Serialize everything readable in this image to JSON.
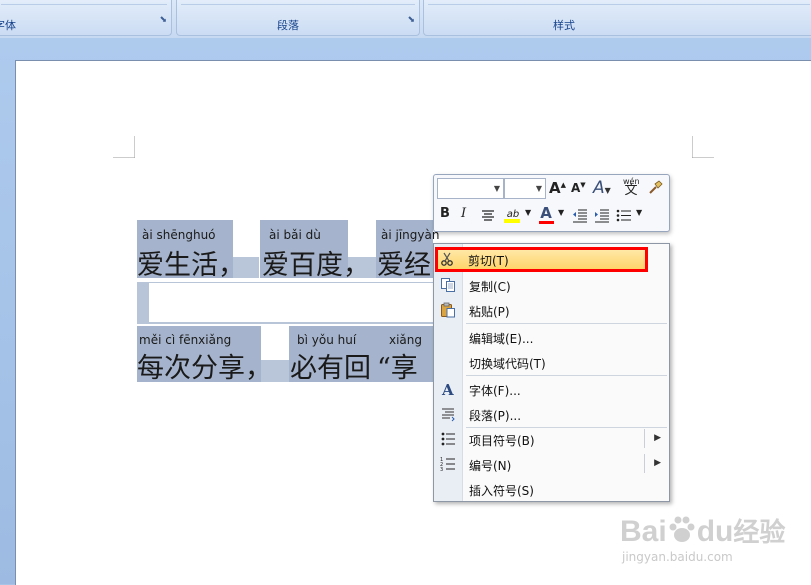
{
  "ribbon": {
    "groups": [
      {
        "title": "字体"
      },
      {
        "title": "段落"
      },
      {
        "title": "样式"
      }
    ]
  },
  "document": {
    "line1": {
      "pinyin": [
        "ài shēnghuó",
        "ài bǎi dù",
        "ài jīngyàn"
      ],
      "hanzi": [
        "爱生活，",
        "爱百度，",
        "爱经"
      ]
    },
    "line2": {
      "pinyin": [
        "měi cì fēnxiǎng",
        "bì yǒu huí",
        "xiǎng"
      ],
      "hanzi": [
        "每次分享，",
        "必有回",
        "“享"
      ]
    }
  },
  "mini_toolbar": {
    "font_name": "",
    "font_size": "",
    "grow_font": "A",
    "shrink_font": "A",
    "styles": "A",
    "phonetic": "wén",
    "phonetic_char": "文",
    "bold": "B",
    "italic": "I",
    "highlight": "ab",
    "font_color": "A",
    "highlight_color": "#ffff00",
    "font_color_value": "#ff0000"
  },
  "context_menu": {
    "items": [
      {
        "label": "剪切(T)",
        "icon": "scissors-icon"
      },
      {
        "label": "复制(C)",
        "icon": "copy-icon"
      },
      {
        "label": "粘贴(P)",
        "icon": "paste-icon"
      },
      {
        "label": "编辑域(E)...",
        "icon": ""
      },
      {
        "label": "切换域代码(T)",
        "icon": ""
      },
      {
        "label": "字体(F)...",
        "icon": "font-icon"
      },
      {
        "label": "段落(P)...",
        "icon": "paragraph-icon"
      },
      {
        "label": "项目符号(B)",
        "icon": "bullets-icon"
      },
      {
        "label": "编号(N)",
        "icon": "numbering-icon"
      },
      {
        "label": "插入符号(S)",
        "icon": ""
      }
    ],
    "highlighted_index": 0,
    "highlight_outline_color": "#ff0000"
  },
  "watermark": {
    "brand": "Bai",
    "brand2": "du",
    "suffix": "经验",
    "url": "jingyan.baidu.com"
  }
}
